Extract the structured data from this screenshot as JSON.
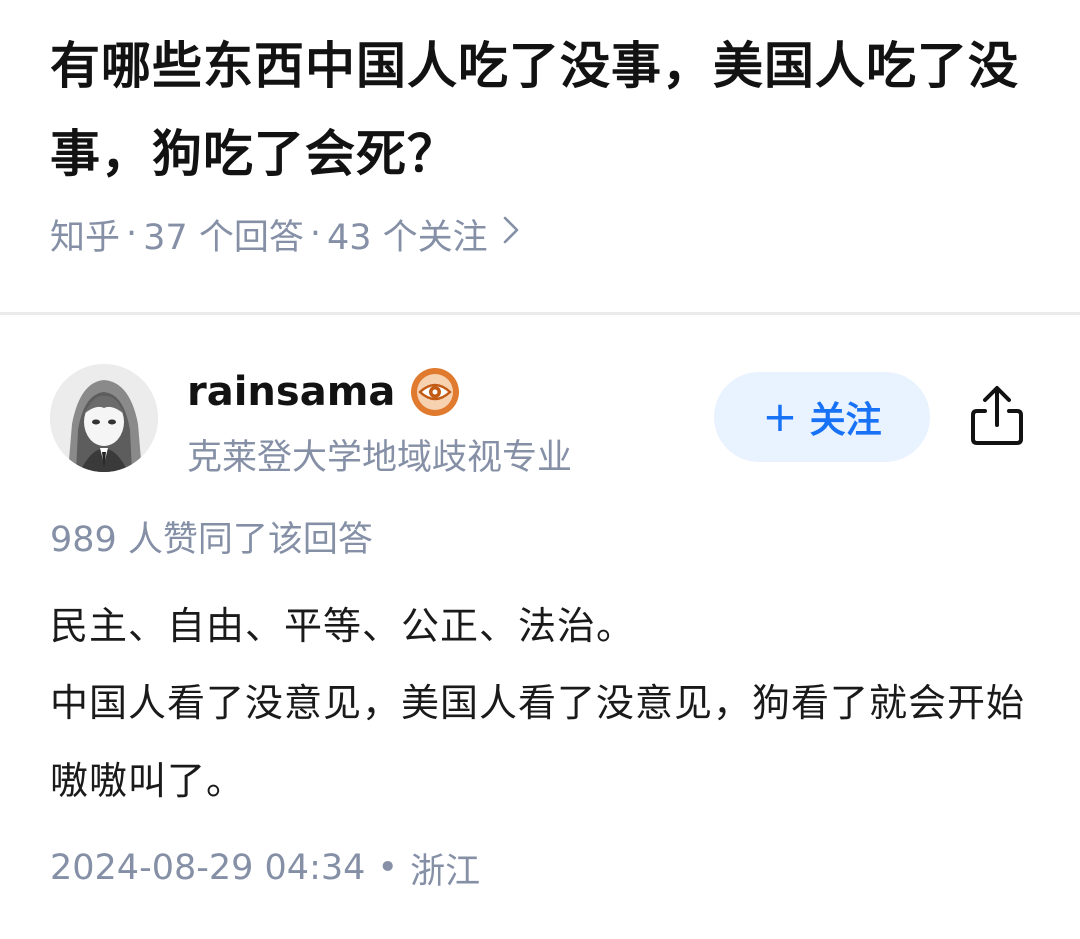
{
  "question": {
    "title": "有哪些东西中国人吃了没事，美国人吃了没事，狗吃了会死？",
    "source": "知乎",
    "answer_count": "37 个回答",
    "follower_count": "43 个关注",
    "separator": "·",
    "chevron_icon": "chevron-right-icon"
  },
  "author": {
    "name": "rainsama",
    "headline": "克莱登大学地域歧视专业",
    "avatar_icon": "avatar",
    "badge_icon": "eye-badge-icon"
  },
  "actions": {
    "follow_plus": "+",
    "follow_label": "关注",
    "share_icon": "share-icon"
  },
  "answer": {
    "vote_text": "989 人赞同了该回答",
    "paragraphs": [
      "民主、自由、平等、公正、法治。",
      "中国人看了没意见，美国人看了没意见，狗看了就会开始嗷嗷叫了。"
    ],
    "date": "2024-08-29 04:34",
    "dot": "•",
    "location": "浙江"
  },
  "colors": {
    "follow_bg": "#e9f2ff",
    "follow_text": "#1772f6",
    "badge_orange": "#e07a2f",
    "muted_text": "#8590a6"
  }
}
